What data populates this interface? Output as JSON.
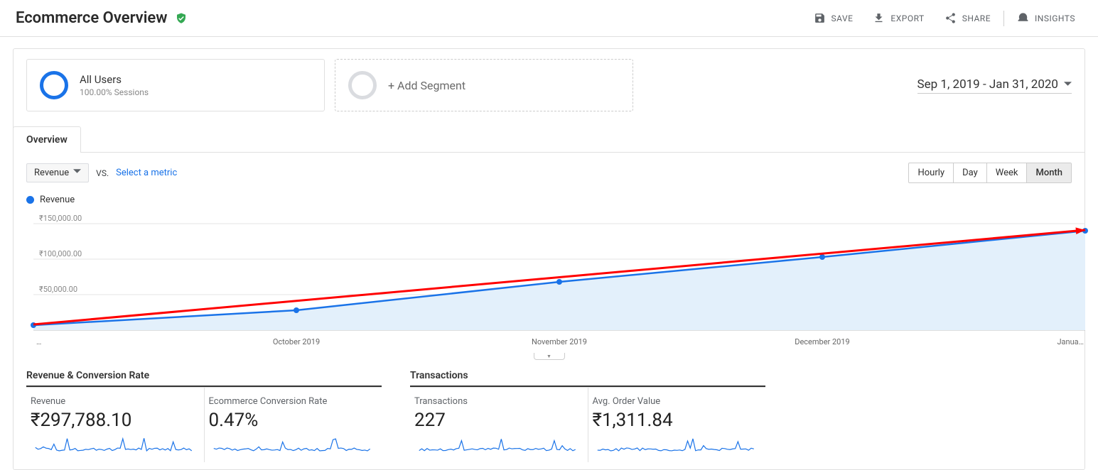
{
  "header": {
    "title": "Ecommerce Overview",
    "actions": {
      "save": "SAVE",
      "export": "EXPORT",
      "share": "SHARE",
      "insights": "INSIGHTS"
    }
  },
  "segments": {
    "primary_title": "All Users",
    "primary_sub": "100.00% Sessions",
    "add_label": "+ Add Segment"
  },
  "date_range": "Sep 1, 2019 - Jan 31, 2020",
  "tabs": {
    "overview": "Overview"
  },
  "controls": {
    "metric": "Revenue",
    "vs": "VS.",
    "select_metric": "Select a metric",
    "granularity": [
      "Hourly",
      "Day",
      "Week",
      "Month"
    ],
    "active_gran": 3
  },
  "legend": {
    "series_name": "Revenue"
  },
  "chart_data": {
    "type": "line",
    "x": [
      "…",
      "October 2019",
      "November 2019",
      "December 2019",
      "Janua…"
    ],
    "series": [
      {
        "name": "Revenue",
        "values": [
          7000,
          28000,
          68000,
          103000,
          140000
        ],
        "color": "#1a73e8"
      }
    ],
    "trend_line": {
      "from": [
        0,
        8000
      ],
      "to": [
        4,
        141000
      ],
      "color": "#ff0000"
    },
    "ylim": [
      0,
      160000
    ],
    "yticks": [
      "₹50,000.00",
      "₹100,000.00",
      "₹150,000.00"
    ],
    "ytick_vals": [
      50000,
      100000,
      150000
    ]
  },
  "metrics": {
    "col1": {
      "title": "Revenue & Conversion Rate",
      "stats": [
        {
          "label": "Revenue",
          "value": "₹297,788.10"
        },
        {
          "label": "Ecommerce Conversion Rate",
          "value": "0.47%"
        }
      ]
    },
    "col2": {
      "title": "Transactions",
      "stats": [
        {
          "label": "Transactions",
          "value": "227"
        },
        {
          "label": "Avg. Order Value",
          "value": "₹1,311.84"
        }
      ]
    }
  }
}
